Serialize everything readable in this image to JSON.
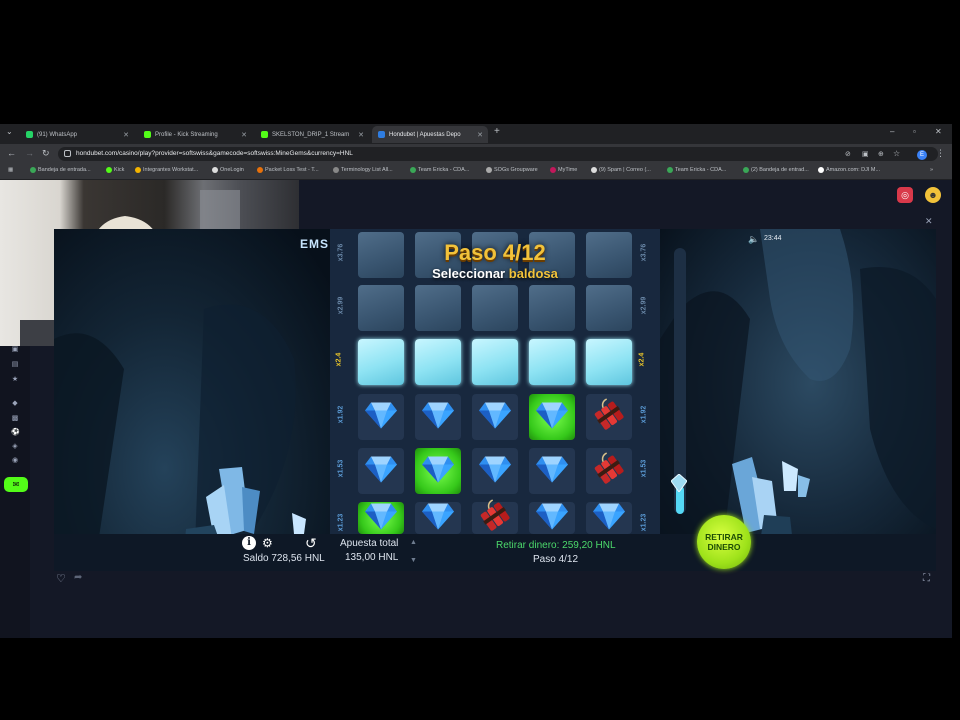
{
  "browser": {
    "tabs": [
      {
        "label": "(91) WhatsApp",
        "color": "#25d366"
      },
      {
        "label": "Profile - Kick Streaming",
        "color": "#53fc18"
      },
      {
        "label": "SKELSTON_DRIP_1 Stream",
        "color": "#53fc18"
      },
      {
        "label": "Hondubet | Apuestas Depo",
        "color": "#2f7de1"
      }
    ],
    "new_tab": "+",
    "url": "hondubet.com/casino/play?provider=softswiss&gamecode=softswiss:MineGems&currency=HNL",
    "profile_initial": "E",
    "bookmarks": [
      "Bandeja de entrada...",
      "Kick",
      "Integrantes Workstat...",
      "OneLogin",
      "Packet Loss Test - T...",
      "Terminology List All...",
      "Team Ericka - CDA...",
      "SOGs Groupware",
      "MyTime",
      "(9) Spam | Correo (...",
      "Team Ericka - CDA...",
      "(2) Bandeja de entrad...",
      "Amazon.com: DJI M..."
    ]
  },
  "game": {
    "partial_logo": "EMS",
    "title": "Paso 4/12",
    "subtitle_white": "Seleccionar",
    "subtitle_gold": "baldosa",
    "clock": "23:44",
    "rows": [
      {
        "mult": "x3.76",
        "state": "ice",
        "tiles": [
          "",
          "",
          "",
          "",
          ""
        ]
      },
      {
        "mult": "x2.99",
        "state": "ice",
        "tiles": [
          "",
          "",
          "",
          "",
          ""
        ]
      },
      {
        "mult": "x2.4",
        "state": "active",
        "tiles": [
          "",
          "",
          "",
          "",
          ""
        ]
      },
      {
        "mult": "x1.92",
        "state": "open",
        "tiles": [
          "gem",
          "gem",
          "gem",
          "gem-win",
          "dynamite"
        ]
      },
      {
        "mult": "x1.53",
        "state": "open",
        "tiles": [
          "gem",
          "gem-win",
          "gem",
          "gem",
          "dynamite"
        ]
      },
      {
        "mult": "x1.23",
        "state": "open",
        "tiles": [
          "gem-win",
          "gem",
          "dynamite",
          "gem",
          "gem"
        ]
      }
    ],
    "progress_fraction": 0.25
  },
  "bottom": {
    "saldo_label": "Saldo",
    "saldo_value": "728,56 HNL",
    "apuesta_label": "Apuesta total",
    "apuesta_value": "135,00 HNL",
    "retirar_text": "Retirar dinero: 259,20 HNL",
    "paso_text": "Paso 4/12",
    "cashout_line1": "RETIRAR",
    "cashout_line2": "DINERO"
  },
  "colors": {
    "gold": "#f2c23a",
    "win_green": "#35c81a",
    "cashout": "#9ee21a",
    "retirar_text": "#4cd96b"
  },
  "icons": [
    "info-icon",
    "settings-icon",
    "history-icon",
    "sound-icon",
    "heart-icon",
    "share-icon",
    "fullscreen-icon",
    "close-icon"
  ]
}
